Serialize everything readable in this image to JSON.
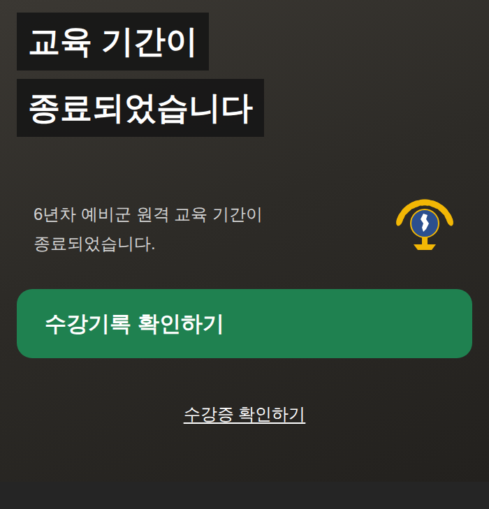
{
  "title_lines": [
    "교육 기간이",
    "종료되었습니다"
  ],
  "message_lines": [
    "6년차 예비군 원격 교육 기간이",
    "종료되었습니다."
  ],
  "primary_button": "수강기록 확인하기",
  "secondary_link": "수강증 확인하기"
}
